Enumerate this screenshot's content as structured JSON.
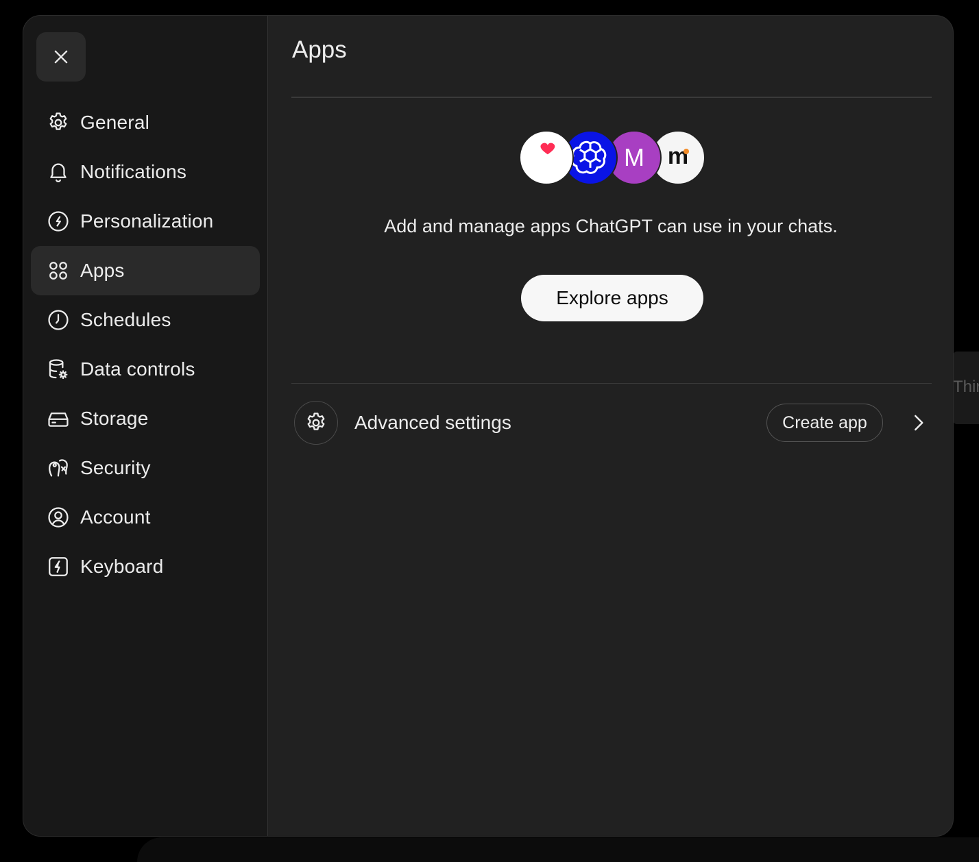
{
  "backdrop": {
    "peek_text": "Thir"
  },
  "sidebar": {
    "close_icon": "close-icon",
    "items": [
      {
        "label": "General",
        "icon": "gear-icon",
        "active": false
      },
      {
        "label": "Notifications",
        "icon": "bell-icon",
        "active": false
      },
      {
        "label": "Personalization",
        "icon": "personalization-icon",
        "active": false
      },
      {
        "label": "Apps",
        "icon": "apps-grid-icon",
        "active": true
      },
      {
        "label": "Schedules",
        "icon": "clock-icon",
        "active": false
      },
      {
        "label": "Data controls",
        "icon": "database-gear-icon",
        "active": false
      },
      {
        "label": "Storage",
        "icon": "drive-icon",
        "active": false
      },
      {
        "label": "Security",
        "icon": "security-icon",
        "active": false
      },
      {
        "label": "Account",
        "icon": "user-circle-icon",
        "active": false
      },
      {
        "label": "Keyboard",
        "icon": "keyboard-bolt-icon",
        "active": false
      }
    ]
  },
  "main": {
    "title": "Apps",
    "app_icons": [
      {
        "name": "heart-app-icon",
        "bg": "#ffffff",
        "accent": "#ff2d55"
      },
      {
        "name": "openai-app-icon",
        "bg": "#0a14e6",
        "accent": "#ffffff"
      },
      {
        "name": "letter-app-icon",
        "bg": "#a83fc2",
        "letter": "M"
      },
      {
        "name": "m-dot-app-icon",
        "bg": "#f5f5f5",
        "letter": "m",
        "accent": "#f28c28"
      }
    ],
    "description": "Add and manage apps ChatGPT can use in your chats.",
    "explore_label": "Explore apps",
    "advanced": {
      "label": "Advanced settings",
      "create_label": "Create app"
    }
  },
  "colors": {
    "modal_bg": "#212121",
    "sidebar_bg": "#181818",
    "active_item_bg": "#2a2a2a",
    "text": "#ececec"
  }
}
